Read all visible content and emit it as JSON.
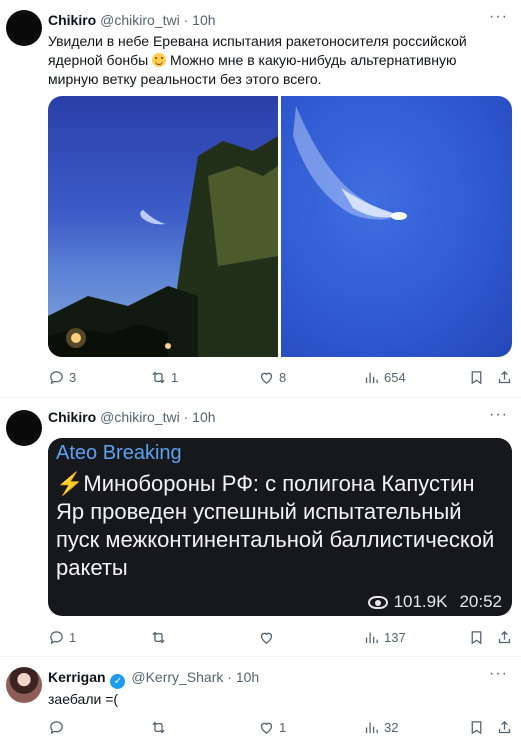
{
  "tweets": [
    {
      "author": "Chikiro",
      "handle": "@chikiro_twi",
      "time": "10h",
      "text_before_emoji": "Увидели в небе Еревана испытания ракетоносителя российской ядерной бонбы",
      "text_after_emoji": " Можно мне в какую-нибудь альтернативную мирную ветку реальности без этого всего.",
      "stats": {
        "replies": "3",
        "retweets": "1",
        "likes": "8",
        "views": "654"
      }
    },
    {
      "author": "Chikiro",
      "handle": "@chikiro_twi",
      "time": "10h",
      "card": {
        "title": "Ateo Breaking",
        "body": "⚡Минобороны РФ: с полигона Капустин Яр проведен успешный испытательный пуск межконтинентальной баллистической ракеты",
        "views": "101.9K",
        "time": "20:52"
      },
      "stats": {
        "replies": "1",
        "retweets": "",
        "likes": "",
        "views": "137"
      }
    },
    {
      "author": "Kerrigan",
      "handle": "@Kerry_Shark",
      "time": "10h",
      "text": "заебали =(",
      "stats": {
        "replies": "",
        "retweets": "",
        "likes": "1",
        "views": "32"
      }
    }
  ],
  "separator": "·",
  "more_glyph": "···",
  "colors": {
    "accent": "#1d9bf0",
    "muted": "#536471",
    "card_title": "#5aa2f0"
  }
}
